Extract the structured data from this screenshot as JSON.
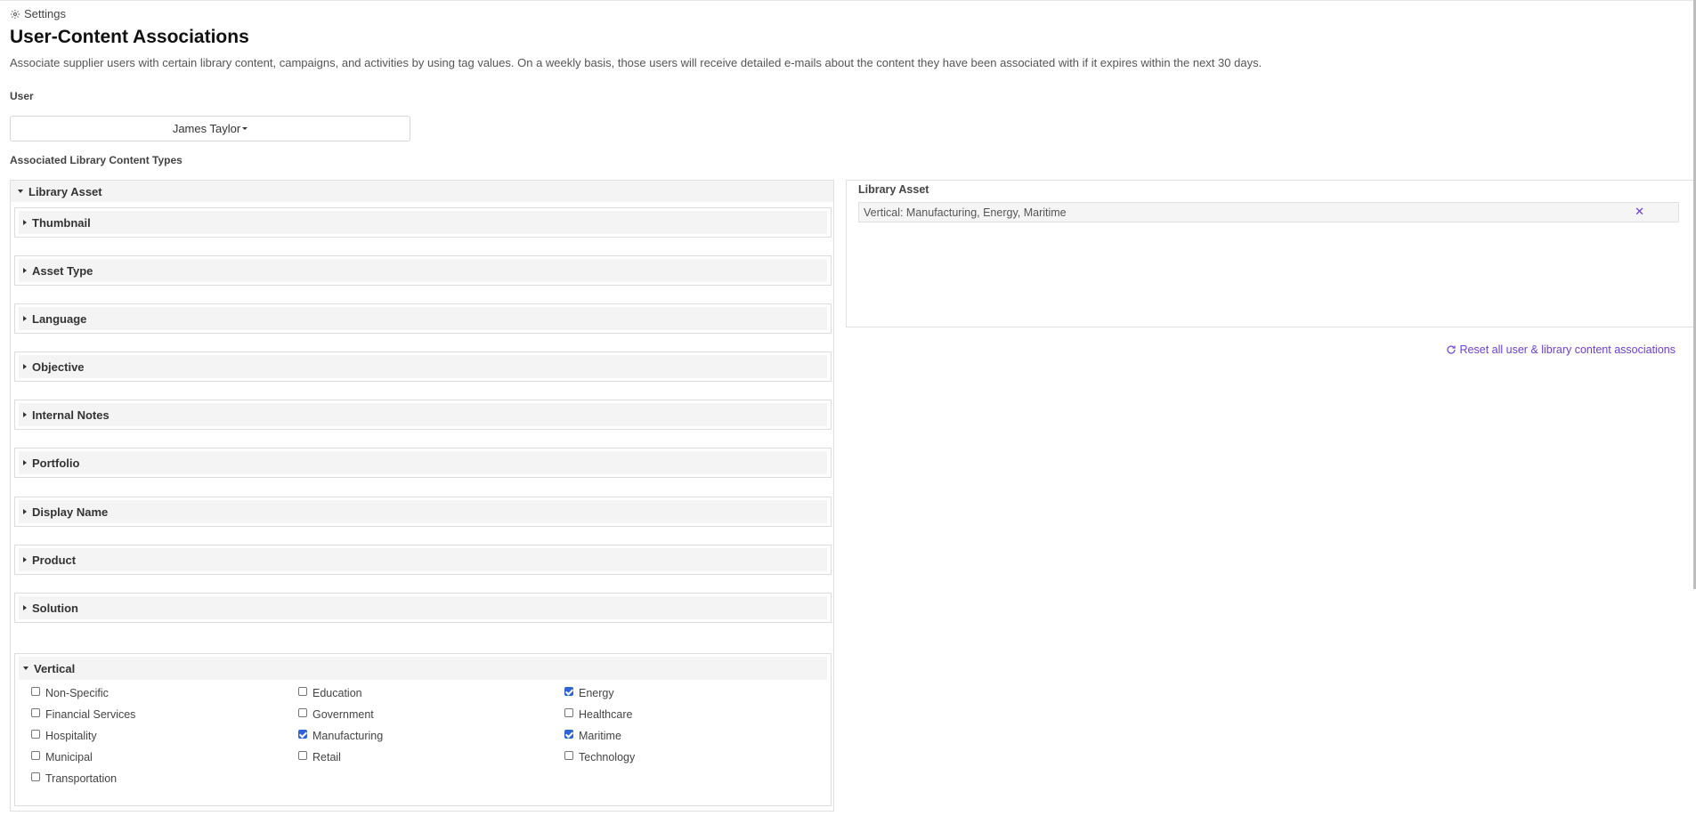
{
  "breadcrumb": {
    "label": "Settings",
    "icon": "gear-icon"
  },
  "page": {
    "title": "User-Content Associations",
    "description": "Associate supplier users with certain library content, campaigns, and activities by using tag values. On a weekly basis, those users will receive detailed e-mails about the content they have been associated with if it expires within the next 30 days."
  },
  "user": {
    "label": "User",
    "selected": "James Taylor"
  },
  "types_label": "Associated Library Content Types",
  "library": {
    "title": "Library Asset",
    "sections": [
      {
        "label": "Thumbnail",
        "expanded": false
      },
      {
        "label": "Asset Type",
        "expanded": false
      },
      {
        "label": "Language",
        "expanded": false
      },
      {
        "label": "Objective",
        "expanded": false
      },
      {
        "label": "Internal Notes",
        "expanded": false
      },
      {
        "label": "Portfolio",
        "expanded": false
      },
      {
        "label": "Display Name",
        "expanded": false
      },
      {
        "label": "Product",
        "expanded": false
      },
      {
        "label": "Solution",
        "expanded": false
      }
    ],
    "vertical": {
      "label": "Vertical",
      "expanded": true,
      "options": [
        {
          "label": "Non-Specific",
          "checked": false
        },
        {
          "label": "Education",
          "checked": false
        },
        {
          "label": "Energy",
          "checked": true
        },
        {
          "label": "Financial Services",
          "checked": false
        },
        {
          "label": "Government",
          "checked": false
        },
        {
          "label": "Healthcare",
          "checked": false
        },
        {
          "label": "Hospitality",
          "checked": false
        },
        {
          "label": "Manufacturing",
          "checked": true
        },
        {
          "label": "Maritime",
          "checked": true
        },
        {
          "label": "Municipal",
          "checked": false
        },
        {
          "label": "Retail",
          "checked": false
        },
        {
          "label": "Technology",
          "checked": false
        },
        {
          "label": "Transportation",
          "checked": false
        }
      ]
    }
  },
  "right": {
    "title": "Library Asset",
    "associations": [
      {
        "text": "Vertical: Manufacturing, Energy, Maritime",
        "remove_icon": "close-icon"
      }
    ],
    "reset_label": "Reset all user & library content associations",
    "reset_icon": "refresh-icon"
  },
  "colors": {
    "accent": "#6b3fd4",
    "checkbox_checked": "#2f64d6",
    "section_bg": "#f4f4f4"
  }
}
